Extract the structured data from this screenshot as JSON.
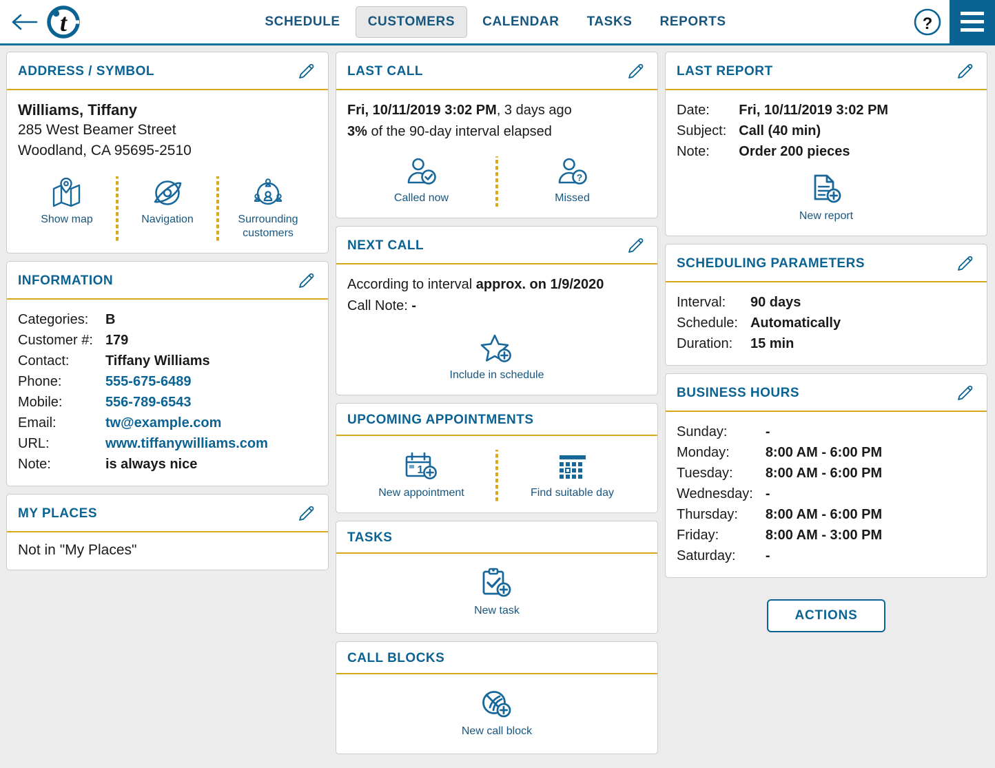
{
  "header": {
    "back_icon": "arrow-left-icon",
    "logo_letter": "t",
    "nav": [
      {
        "label": "SCHEDULE",
        "active": false
      },
      {
        "label": "CUSTOMERS",
        "active": true
      },
      {
        "label": "CALENDAR",
        "active": false
      },
      {
        "label": "TASKS",
        "active": false
      },
      {
        "label": "REPORTS",
        "active": false
      }
    ],
    "help_icon": "question-mark-icon",
    "menu_icon": "hamburger-menu-icon"
  },
  "address_panel": {
    "title": "ADDRESS / SYMBOL",
    "edit_icon": "pencil-icon",
    "customer_name": "Williams, Tiffany",
    "street": "285 West Beamer Street",
    "city_state_zip": "Woodland, CA 95695-2510",
    "actions": [
      {
        "label": "Show map",
        "icon": "map-pin-icon"
      },
      {
        "label": "Navigation",
        "icon": "navigation-eye-icon"
      },
      {
        "label": "Surrounding customers",
        "icon": "surrounding-customers-icon"
      }
    ]
  },
  "information_panel": {
    "title": "INFORMATION",
    "edit_icon": "pencil-icon",
    "rows": [
      {
        "key": "Categories:",
        "value": "B",
        "link": false
      },
      {
        "key": "Customer #:",
        "value": "179",
        "link": false
      },
      {
        "key": "Contact:",
        "value": "Tiffany Williams",
        "link": false
      },
      {
        "key": "Phone:",
        "value": "555-675-6489",
        "link": true
      },
      {
        "key": "Mobile:",
        "value": "556-789-6543",
        "link": true
      },
      {
        "key": "Email:",
        "value": "tw@example.com",
        "link": true
      },
      {
        "key": "URL:",
        "value": "www.tiffanywilliams.com",
        "link": true
      },
      {
        "key": "Note:",
        "value": "is always nice",
        "link": false
      }
    ]
  },
  "my_places_panel": {
    "title": "MY PLACES",
    "edit_icon": "pencil-icon",
    "body": "Not in \"My Places\""
  },
  "last_call_panel": {
    "title": "LAST CALL",
    "edit_icon": "pencil-icon",
    "line1_bold": "Fri, 10/11/2019 3:02 PM",
    "line1_rest": ", 3 days ago",
    "line2_bold": "3%",
    "line2_rest": " of the 90-day interval elapsed",
    "actions": [
      {
        "label": "Called now",
        "icon": "person-check-icon"
      },
      {
        "label": "Missed",
        "icon": "person-question-icon"
      }
    ]
  },
  "next_call_panel": {
    "title": "NEXT CALL",
    "edit_icon": "pencil-icon",
    "line1_rest": "According to interval ",
    "line1_bold": "approx. on 1/9/2020",
    "line2_rest": "Call Note: ",
    "line2_bold": "-",
    "actions": [
      {
        "label": "Include in schedule",
        "icon": "star-plus-icon"
      }
    ]
  },
  "upcoming_panel": {
    "title": "UPCOMING APPOINTMENTS",
    "actions": [
      {
        "label": "New appointment",
        "icon": "calendar-plus-icon"
      },
      {
        "label": "Find suitable day",
        "icon": "calendar-grid-icon"
      }
    ]
  },
  "tasks_panel": {
    "title": "TASKS",
    "actions": [
      {
        "label": "New task",
        "icon": "clipboard-check-plus-icon"
      }
    ]
  },
  "call_blocks_panel": {
    "title": "CALL BLOCKS",
    "actions": [
      {
        "label": "New call block",
        "icon": "call-block-plus-icon"
      }
    ]
  },
  "last_report_panel": {
    "title": "LAST REPORT",
    "edit_icon": "pencil-icon",
    "rows": [
      {
        "key": "Date:",
        "value": "Fri, 10/11/2019 3:02 PM"
      },
      {
        "key": "Subject:",
        "value": "Call (40 min)"
      },
      {
        "key": "Note:",
        "value": "Order 200 pieces"
      }
    ],
    "actions": [
      {
        "label": "New report",
        "icon": "document-plus-icon"
      }
    ]
  },
  "scheduling_panel": {
    "title": "SCHEDULING PARAMETERS",
    "edit_icon": "pencil-icon",
    "rows": [
      {
        "key": "Interval:",
        "value": "90 days"
      },
      {
        "key": "Schedule:",
        "value": "Automatically"
      },
      {
        "key": "Duration:",
        "value": "15 min"
      }
    ]
  },
  "business_hours_panel": {
    "title": "BUSINESS HOURS",
    "edit_icon": "pencil-icon",
    "rows": [
      {
        "key": "Sunday:",
        "value": "-"
      },
      {
        "key": "Monday:",
        "value": "8:00 AM - 6:00 PM"
      },
      {
        "key": "Tuesday:",
        "value": "8:00 AM - 6:00 PM"
      },
      {
        "key": "Wednesday:",
        "value": "-"
      },
      {
        "key": "Thursday:",
        "value": "8:00 AM - 6:00 PM"
      },
      {
        "key": "Friday:",
        "value": "8:00 AM - 3:00 PM"
      },
      {
        "key": "Saturday:",
        "value": "-"
      }
    ]
  },
  "actions_button": {
    "label": "ACTIONS"
  },
  "colors": {
    "brand_blue": "#0b6394",
    "nav_blue": "#17567f",
    "accent_gold": "#d9a81b",
    "page_bg": "#ececec",
    "panel_border": "#cccccc"
  }
}
